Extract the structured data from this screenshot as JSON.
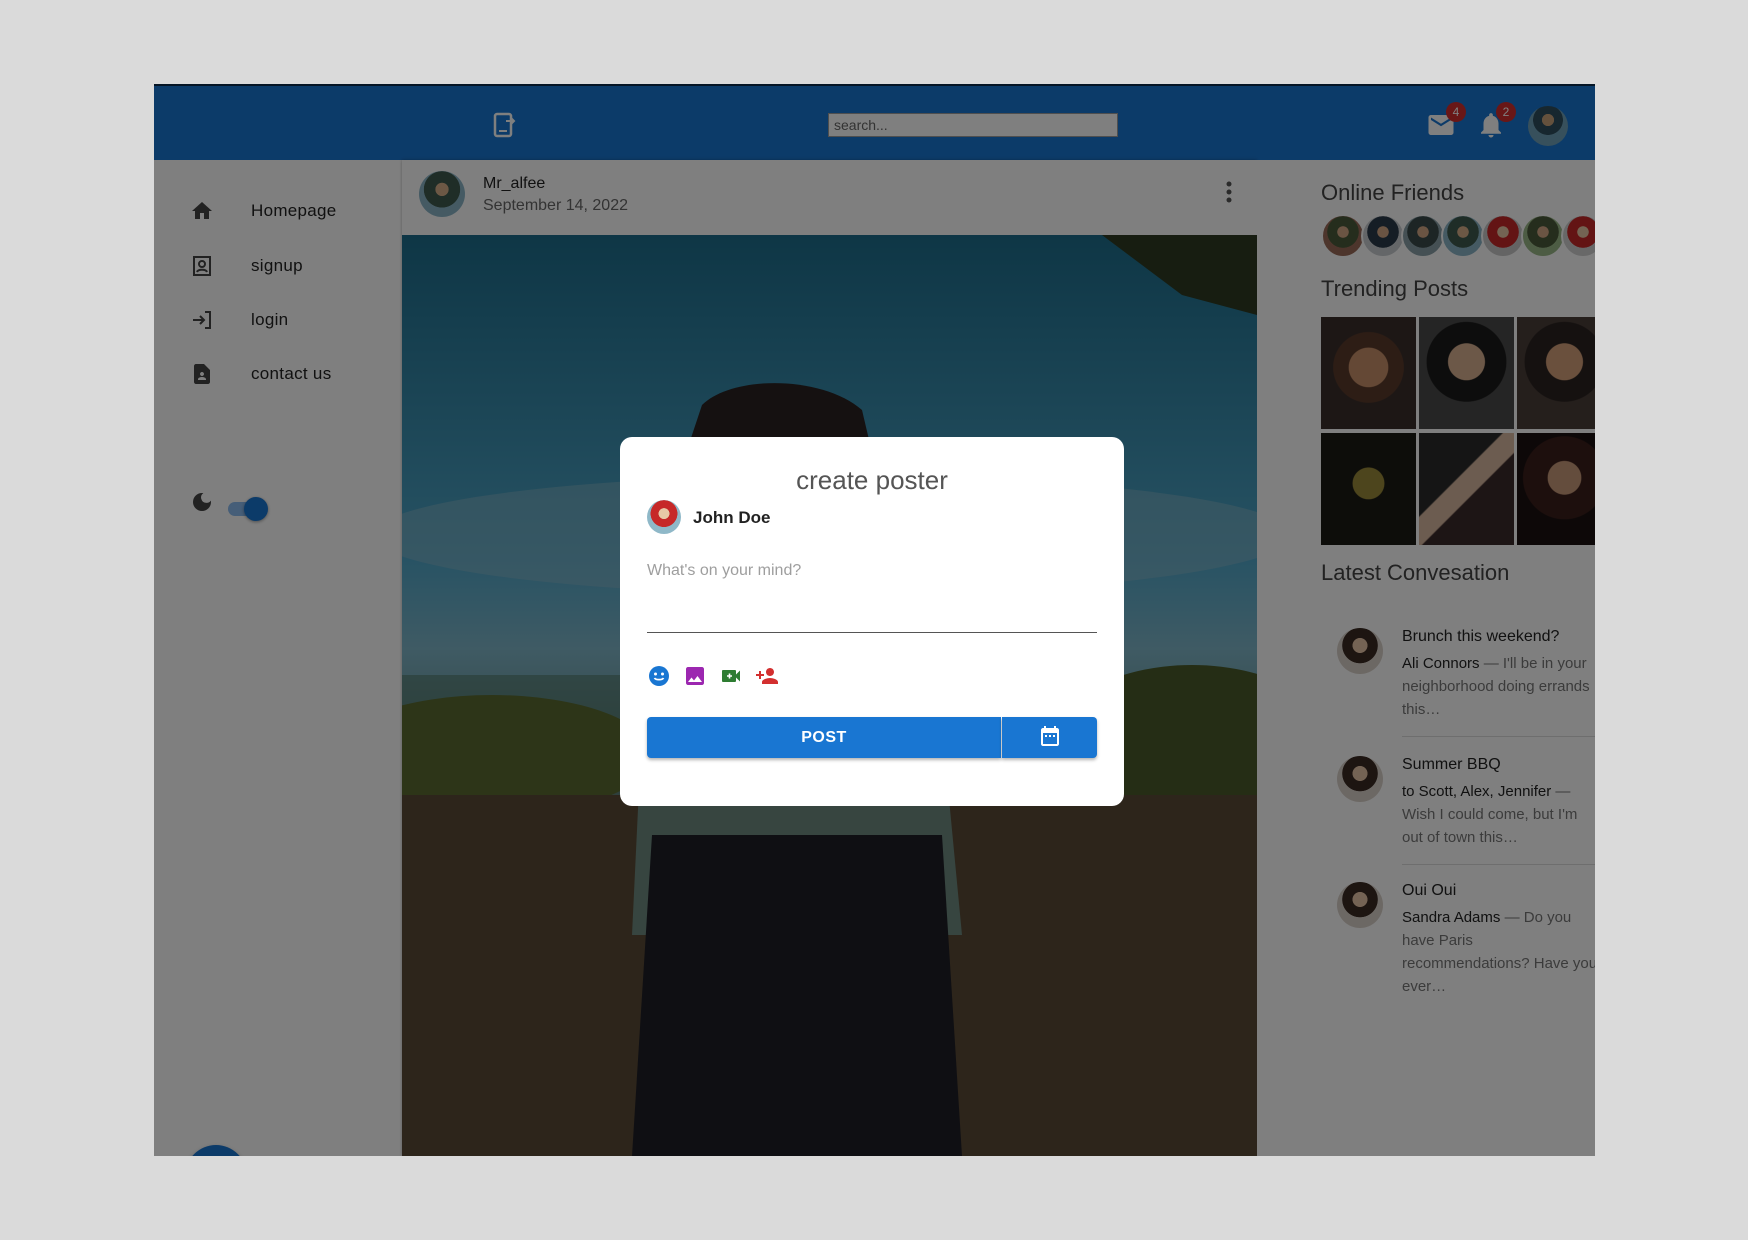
{
  "topbar": {
    "search_placeholder": "search...",
    "messages_count": "4",
    "notifications_count": "2",
    "accent": "#1976d2"
  },
  "sidebar": {
    "items": [
      {
        "label": "Homepage",
        "icon": "home-icon"
      },
      {
        "label": "signup",
        "icon": "account-box-icon"
      },
      {
        "label": "login",
        "icon": "login-icon"
      },
      {
        "label": "contact us",
        "icon": "contact-page-icon"
      }
    ],
    "dark_mode_icon": "moon-icon",
    "dark_mode_on": true,
    "fab_label": "+"
  },
  "post": {
    "username": "Mr_alfee",
    "date": "September 14, 2022"
  },
  "right": {
    "online_title": "Online Friends",
    "trending_title": "Trending Posts",
    "latest_title": "Latest Convesation",
    "conversations": [
      {
        "title": "Brunch this weekend?",
        "who": "Ali Connors",
        "text": " — I'll be in your neighborhood doing errands this…"
      },
      {
        "title": "Summer BBQ",
        "who": "to Scott, Alex, Jennifer",
        "text": " — Wish I could come, but I'm out of town this…"
      },
      {
        "title": "Oui Oui",
        "who": "Sandra Adams",
        "text": " — Do you have Paris recommendations? Have you ever…"
      }
    ]
  },
  "modal": {
    "title": "create poster",
    "user": "John Doe",
    "placeholder": "What's on your mind?",
    "post_label": "POST",
    "icons": [
      "emoji-icon",
      "image-icon",
      "video-icon",
      "tag-person-icon"
    ]
  }
}
